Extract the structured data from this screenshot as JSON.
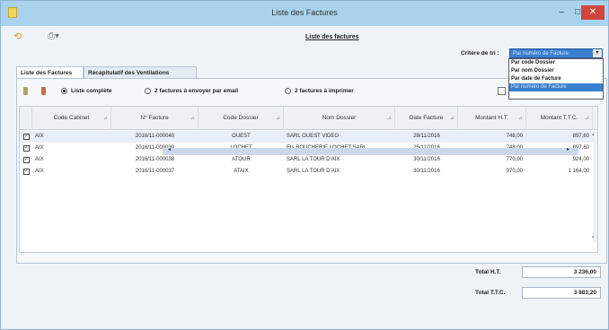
{
  "window": {
    "title": "Liste des Factures",
    "minimize": "–",
    "maximize": "□",
    "close": "✕"
  },
  "toolbar": {
    "back_icon": "⟲",
    "print_icon": "⎙▾",
    "page_title": "Liste des factures"
  },
  "criteria": {
    "label": "Critère de tri :",
    "selected": "Par numéro de Facture",
    "arrow": "▾",
    "options": [
      "Par code Dossier",
      "Par nom Dossier",
      "Par date de Facture",
      "Par numéro de Facture"
    ]
  },
  "tabs": [
    "Liste des Factures",
    "Récapitulatif des Ventilations"
  ],
  "filters": {
    "options": [
      "Liste complète",
      "2 factures à envoyer par email",
      "2 factures à imprimer"
    ],
    "selected_index": 0
  },
  "table": {
    "columns": [
      "Code Cabinet",
      "N° Facture",
      "Code Dossier",
      "Nom Dossier",
      "Date Facture",
      "Montant H.T.",
      "Montant T.T.C."
    ],
    "filter_glyph": "⊿",
    "check_glyph": "✓",
    "rows": [
      {
        "checked": true,
        "code_cabinet": "AIX",
        "num": "2016/11-000040",
        "code_dossier": "OUEST",
        "nom": "SARL OUEST VIDEO",
        "date": "28/11/2016",
        "ht": "748,00",
        "ttc": "897,60"
      },
      {
        "checked": true,
        "code_cabinet": "AIX",
        "num": "2016/11-000039",
        "code_dossier": "LOCHET",
        "nom": "Ets BOUCHERIE LOCHET SARL",
        "date": "25/11/2016",
        "ht": "748,00",
        "ttc": "897,60"
      },
      {
        "checked": true,
        "code_cabinet": "AIX",
        "num": "2016/11-000038",
        "code_dossier": "ATOUR",
        "nom": "SARL LA TOUR D'AIX",
        "date": "30/11/2016",
        "ht": "770,00",
        "ttc": "924,00"
      },
      {
        "checked": true,
        "code_cabinet": "AIX",
        "num": "2016/11-000037",
        "code_dossier": "ATAIX",
        "nom": "SARL LA TOUR D'AIX",
        "date": "30/11/2016",
        "ht": "970,00",
        "ttc": "1 164,00"
      }
    ]
  },
  "scroll": {
    "left": "◂",
    "right": "▸",
    "up": "▴",
    "down": "▾"
  },
  "totals": {
    "ht_label": "Total H.T.",
    "ht_value": "3 236,00",
    "ttc_label": "Total T.T.C.",
    "ttc_value": "3 883,20"
  },
  "colors": {
    "titlebar": "#a9d2ec",
    "selection": "#3b7fd0",
    "close": "#d0463d"
  }
}
